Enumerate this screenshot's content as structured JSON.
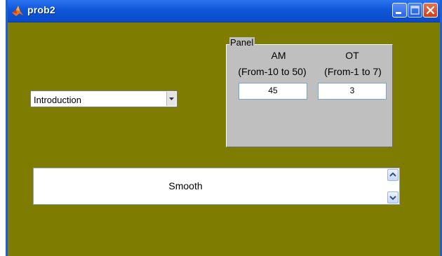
{
  "window": {
    "title": "prob2",
    "buttons": {
      "minimize": "minimize",
      "maximize": "maximize",
      "close": "close"
    }
  },
  "dropdown": {
    "selected": "Introduction"
  },
  "panel": {
    "title": "Panel",
    "am": {
      "label": "AM",
      "range": "(From-10 to 50)",
      "value": "45"
    },
    "ot": {
      "label": "OT",
      "range": "(From-1 to 7)",
      "value": "3"
    }
  },
  "listbox": {
    "items": [
      "Smooth"
    ]
  },
  "colors": {
    "figure_background": "#7f7d01",
    "panel_background": "#bfbfbf",
    "titlebar": "#0f56d8"
  }
}
